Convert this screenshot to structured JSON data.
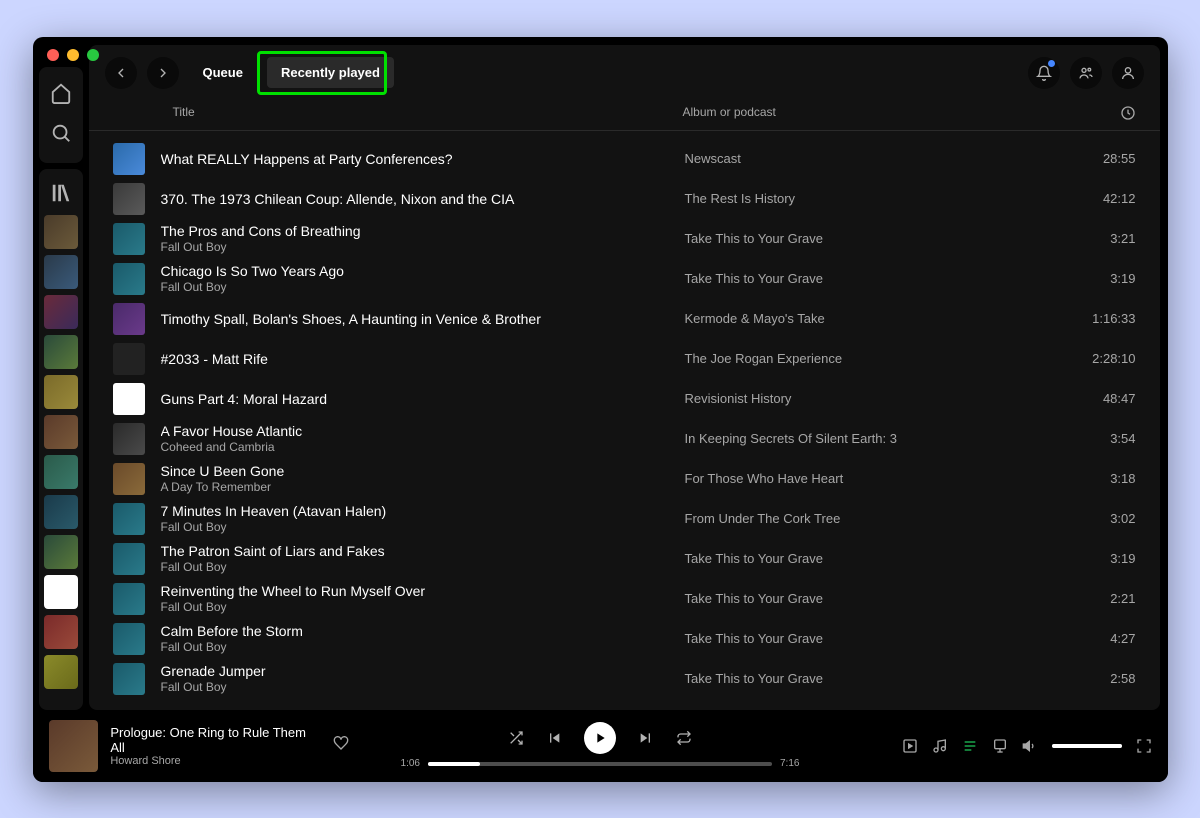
{
  "tabs": {
    "queue": "Queue",
    "recent": "Recently played"
  },
  "cols": {
    "title": "Title",
    "album": "Album or podcast"
  },
  "tracks": [
    {
      "title": "What REALLY Happens at Party Conferences?",
      "artist": "",
      "album": "Newscast",
      "dur": "28:55",
      "art": "art-a"
    },
    {
      "title": "370. The 1973 Chilean Coup: Allende, Nixon and the CIA",
      "artist": "",
      "album": "The Rest Is History",
      "dur": "42:12",
      "art": "art-b"
    },
    {
      "title": "The Pros and Cons of Breathing",
      "artist": "Fall Out Boy",
      "album": "Take This to Your Grave",
      "dur": "3:21",
      "art": "art-c"
    },
    {
      "title": "Chicago Is So Two Years Ago",
      "artist": "Fall Out Boy",
      "album": "Take This to Your Grave",
      "dur": "3:19",
      "art": "art-c"
    },
    {
      "title": "Timothy Spall, Bolan's Shoes, A Haunting in Venice & Brother",
      "artist": "",
      "album": "Kermode & Mayo's Take",
      "dur": "1:16:33",
      "art": "art-d"
    },
    {
      "title": "#2033 - Matt Rife",
      "artist": "",
      "album": "The Joe Rogan Experience",
      "dur": "2:28:10",
      "art": "art-e"
    },
    {
      "title": "Guns Part 4: Moral Hazard",
      "artist": "",
      "album": "Revisionist History",
      "dur": "48:47",
      "art": "art-f"
    },
    {
      "title": "A Favor House Atlantic",
      "artist": "Coheed and Cambria",
      "album": "In Keeping Secrets Of Silent Earth: 3",
      "dur": "3:54",
      "art": "art-g"
    },
    {
      "title": "Since U Been Gone",
      "artist": "A Day To Remember",
      "album": "For Those Who Have Heart",
      "dur": "3:18",
      "art": "art-h"
    },
    {
      "title": "7 Minutes In Heaven (Atavan Halen)",
      "artist": "Fall Out Boy",
      "album": "From Under The Cork Tree",
      "dur": "3:02",
      "art": "art-c"
    },
    {
      "title": "The Patron Saint of Liars and Fakes",
      "artist": "Fall Out Boy",
      "album": "Take This to Your Grave",
      "dur": "3:19",
      "art": "art-c"
    },
    {
      "title": "Reinventing the Wheel to Run Myself Over",
      "artist": "Fall Out Boy",
      "album": "Take This to Your Grave",
      "dur": "2:21",
      "art": "art-c"
    },
    {
      "title": "Calm Before the Storm",
      "artist": "Fall Out Boy",
      "album": "Take This to Your Grave",
      "dur": "4:27",
      "art": "art-c"
    },
    {
      "title": "Grenade Jumper",
      "artist": "Fall Out Boy",
      "album": "Take This to Your Grave",
      "dur": "2:58",
      "art": "art-c"
    }
  ],
  "np": {
    "title": "Prologue: One Ring to Rule Them All",
    "artist": "Howard Shore",
    "elapsed": "1:06",
    "total": "7:16",
    "pct": 15
  }
}
